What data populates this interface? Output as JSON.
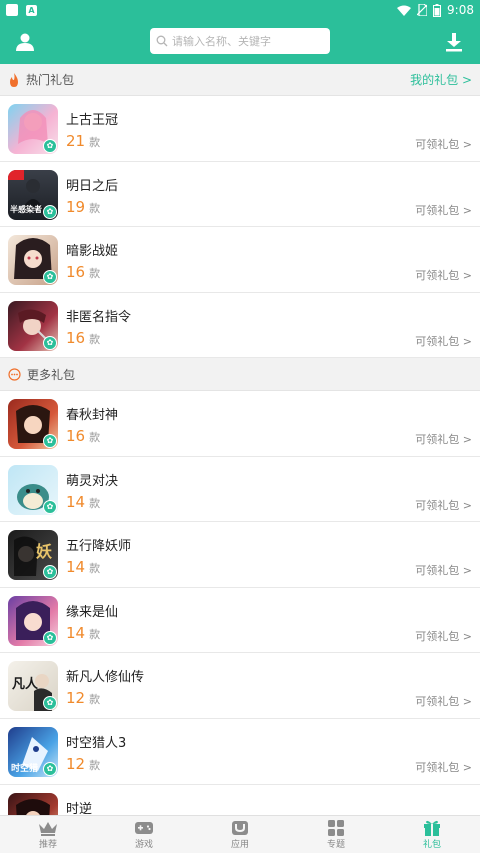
{
  "status": {
    "time": "9:08"
  },
  "search": {
    "placeholder": "请输入名称、关键字"
  },
  "hot": {
    "title": "热门礼包",
    "mine_link": "我的礼包 >"
  },
  "more": {
    "title": "更多礼包"
  },
  "unit": "款",
  "claim_label": "可领礼包 >",
  "hot_items": [
    {
      "name": "上古王冠",
      "count": "21"
    },
    {
      "name": "明日之后",
      "count": "19"
    },
    {
      "name": "暗影战姬",
      "count": "16"
    },
    {
      "name": "非匿名指令",
      "count": "16"
    }
  ],
  "more_items": [
    {
      "name": "春秋封神",
      "count": "16"
    },
    {
      "name": "萌灵对决",
      "count": "14"
    },
    {
      "name": "五行降妖师",
      "count": "14"
    },
    {
      "name": "缘来是仙",
      "count": "14"
    },
    {
      "name": "新凡人修仙传",
      "count": "12"
    },
    {
      "name": "时空猎人3",
      "count": "12"
    },
    {
      "name": "时逆",
      "count": ""
    }
  ],
  "thumb_text": {
    "ming": "半感染者",
    "yao": "妖",
    "fan": "凡人",
    "shikong": "时空猎"
  },
  "tabs": [
    {
      "label": "推荐",
      "icon": "crown-icon"
    },
    {
      "label": "游戏",
      "icon": "gamepad-icon"
    },
    {
      "label": "应用",
      "icon": "app-icon"
    },
    {
      "label": "专题",
      "icon": "grid-icon"
    },
    {
      "label": "礼包",
      "icon": "gift-icon"
    }
  ],
  "colors": {
    "brand": "#2bbf9a",
    "count": "#f08a2c"
  }
}
